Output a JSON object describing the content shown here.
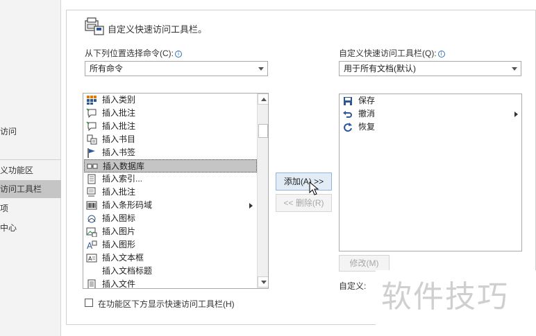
{
  "nav": {
    "items": [
      "访问",
      "义功能区",
      "访问工具栏",
      "项",
      "中心"
    ],
    "selected_index": 2
  },
  "header": {
    "title": "自定义快速访问工具栏。"
  },
  "left": {
    "choose_label": "从下列位置选择命令(C):",
    "choose_value": "所有命令",
    "commands": [
      {
        "label": "插入类别",
        "icon": "category-icon"
      },
      {
        "label": "插入批注",
        "icon": "comment-icon"
      },
      {
        "label": "插入批注",
        "icon": "comment-icon"
      },
      {
        "label": "插入书目",
        "icon": "bibliography-icon"
      },
      {
        "label": "插入书签",
        "icon": "bookmark-icon"
      },
      {
        "label": "插入数据库",
        "icon": "database-icon",
        "selected": true
      },
      {
        "label": "插入索引...",
        "icon": "index-icon"
      },
      {
        "label": "插入批注",
        "icon": "caption-icon"
      },
      {
        "label": "插入条形码域",
        "icon": "barcode-icon",
        "submenu": true
      },
      {
        "label": "插入图标",
        "icon": "icons-icon"
      },
      {
        "label": "插入图片",
        "icon": "picture-icon"
      },
      {
        "label": "插入图形",
        "icon": "shapes-icon"
      },
      {
        "label": "插入文本框",
        "icon": "textbox-icon"
      },
      {
        "label": "插入文档标题",
        "icon": ""
      },
      {
        "label": "插入文件",
        "icon": "file-icon"
      }
    ],
    "show_below_label": "在功能区下方显示快速访问工具栏(H)"
  },
  "middle": {
    "add_label": "添加(A) >>",
    "remove_label": "<< 删除(R)"
  },
  "right": {
    "customize_label": "自定义快速访问工具栏(Q):",
    "customize_value": "用于所有文档(默认)",
    "items": [
      {
        "label": "保存",
        "icon": "save-icon"
      },
      {
        "label": "撤消",
        "icon": "undo-icon",
        "submenu": true
      },
      {
        "label": "恢复",
        "icon": "redo-icon"
      }
    ],
    "modify_label": "修改(M)",
    "custom_label": "自定义:"
  },
  "watermark": "软件技巧"
}
